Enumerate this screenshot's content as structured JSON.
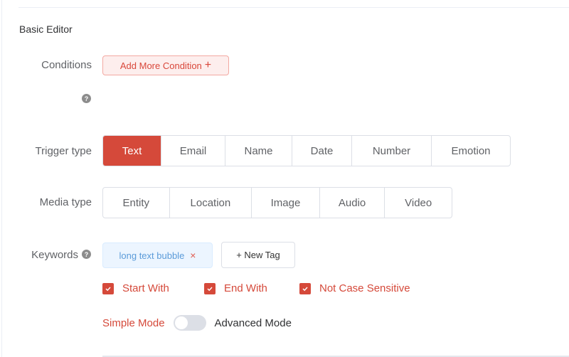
{
  "section_title": "Basic Editor",
  "conditions": {
    "label": "Conditions",
    "add_button_label": "Add More Condition",
    "add_button_icon": "plus-icon",
    "help_icon": "question-circle-icon"
  },
  "trigger_type": {
    "label": "Trigger type",
    "selected": "Text",
    "options": [
      "Text",
      "Email",
      "Name",
      "Date",
      "Number",
      "Emotion"
    ]
  },
  "media_type": {
    "label": "Media type",
    "options": [
      "Entity",
      "Location",
      "Image",
      "Audio",
      "Video"
    ]
  },
  "keywords": {
    "label": "Keywords",
    "help_icon": "question-circle-icon",
    "tags": [
      "long text bubble"
    ],
    "tag_close_glyph": "×",
    "new_tag_label": "+ New Tag"
  },
  "options": {
    "checkboxes": [
      {
        "label": "Start With",
        "checked": true
      },
      {
        "label": "End With",
        "checked": true
      },
      {
        "label": "Not Case Sensitive",
        "checked": true
      }
    ]
  },
  "mode": {
    "simple_label": "Simple Mode",
    "advanced_label": "Advanced Mode",
    "advanced_enabled": false
  },
  "colors": {
    "accent": "#d5493a",
    "tag_text": "#5b9bd9",
    "border": "#dcdfe6"
  }
}
